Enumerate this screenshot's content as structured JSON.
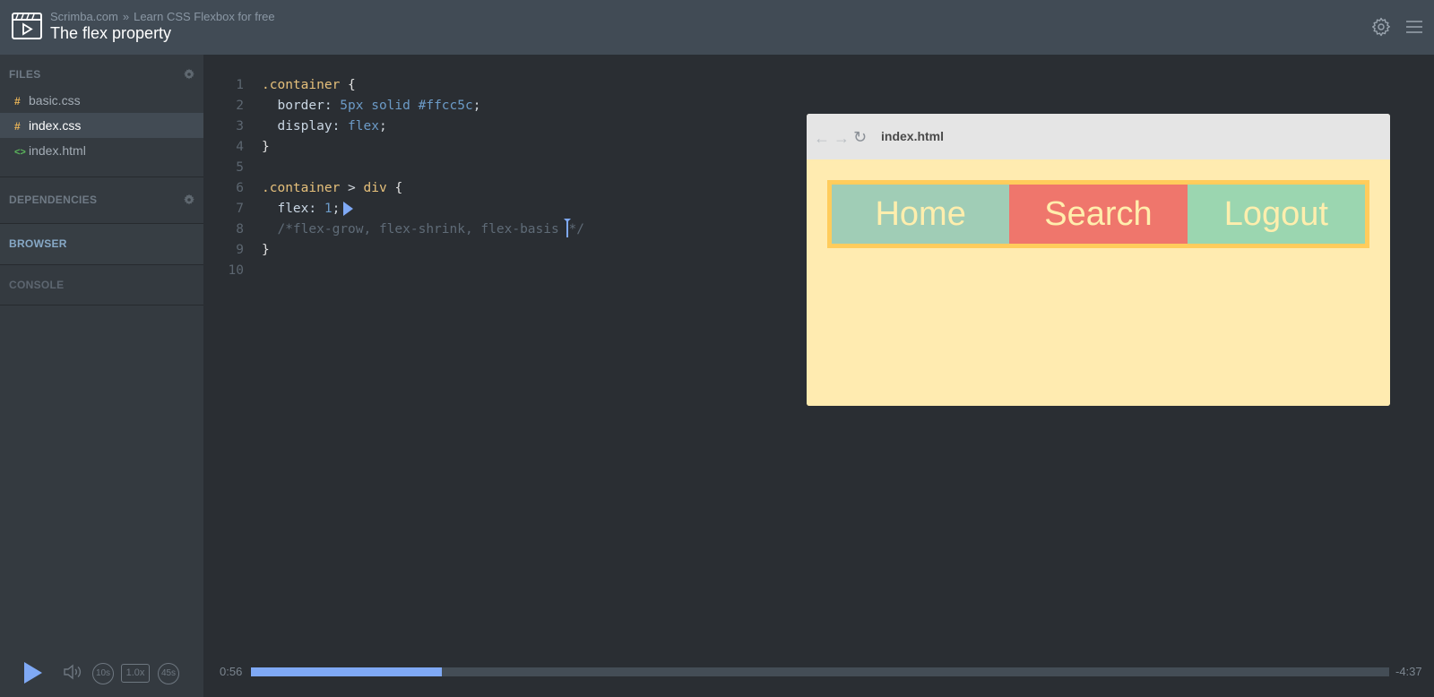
{
  "header": {
    "site": "Scrimba.com",
    "separator": "»",
    "course": "Learn CSS Flexbox for free",
    "title": "The flex property"
  },
  "sidebar": {
    "files_label": "FILES",
    "files": [
      {
        "name": "basic.css",
        "icon": "#",
        "type": "css",
        "active": false
      },
      {
        "name": "index.css",
        "icon": "#",
        "type": "css",
        "active": true
      },
      {
        "name": "index.html",
        "icon": "<>",
        "type": "html",
        "active": false
      }
    ],
    "dependencies_label": "DEPENDENCIES",
    "browser_label": "BROWSER",
    "console_label": "CONSOLE"
  },
  "editor": {
    "line_numbers": [
      "1",
      "2",
      "3",
      "4",
      "5",
      "6",
      "7",
      "8",
      "9",
      "10"
    ],
    "lines": [
      [
        {
          "t": ".container",
          "c": "sel"
        },
        {
          "t": " {",
          "c": "brace"
        }
      ],
      [
        {
          "t": "  border:",
          "c": "prop"
        },
        {
          "t": " 5px solid #ffcc5c",
          "c": "val"
        },
        {
          "t": ";",
          "c": "punc"
        }
      ],
      [
        {
          "t": "  display:",
          "c": "prop"
        },
        {
          "t": " flex",
          "c": "val"
        },
        {
          "t": ";",
          "c": "punc"
        }
      ],
      [
        {
          "t": "}",
          "c": "brace"
        }
      ],
      [],
      [
        {
          "t": ".container",
          "c": "sel"
        },
        {
          "t": " > ",
          "c": "punc"
        },
        {
          "t": "div",
          "c": "sel"
        },
        {
          "t": " {",
          "c": "brace"
        }
      ],
      [
        {
          "t": "  flex:",
          "c": "prop"
        },
        {
          "t": " 1",
          "c": "val"
        },
        {
          "t": ";",
          "c": "punc"
        }
      ],
      [
        {
          "t": "  /*flex-grow, flex-shrink, flex-basis ",
          "c": "cmt"
        }
      ],
      [
        {
          "t": "}",
          "c": "brace"
        }
      ],
      []
    ],
    "comment_tail": "*/"
  },
  "mini_browser": {
    "url": "index.html",
    "nav": [
      {
        "label": "Home",
        "color": "#a0cdb6"
      },
      {
        "label": "Search",
        "color": "#ef766c"
      },
      {
        "label": "Logout",
        "color": "#9bd6b0"
      }
    ],
    "border_color": "#ffcc5c",
    "bg_color": "#ffebb0"
  },
  "player": {
    "current_time": "0:56",
    "remaining_time": "-4:37",
    "progress": 0.168,
    "rewind_label": "10s",
    "speed_label": "1.0x",
    "forward_label": "45s",
    "accent": "#7fa9f5"
  }
}
